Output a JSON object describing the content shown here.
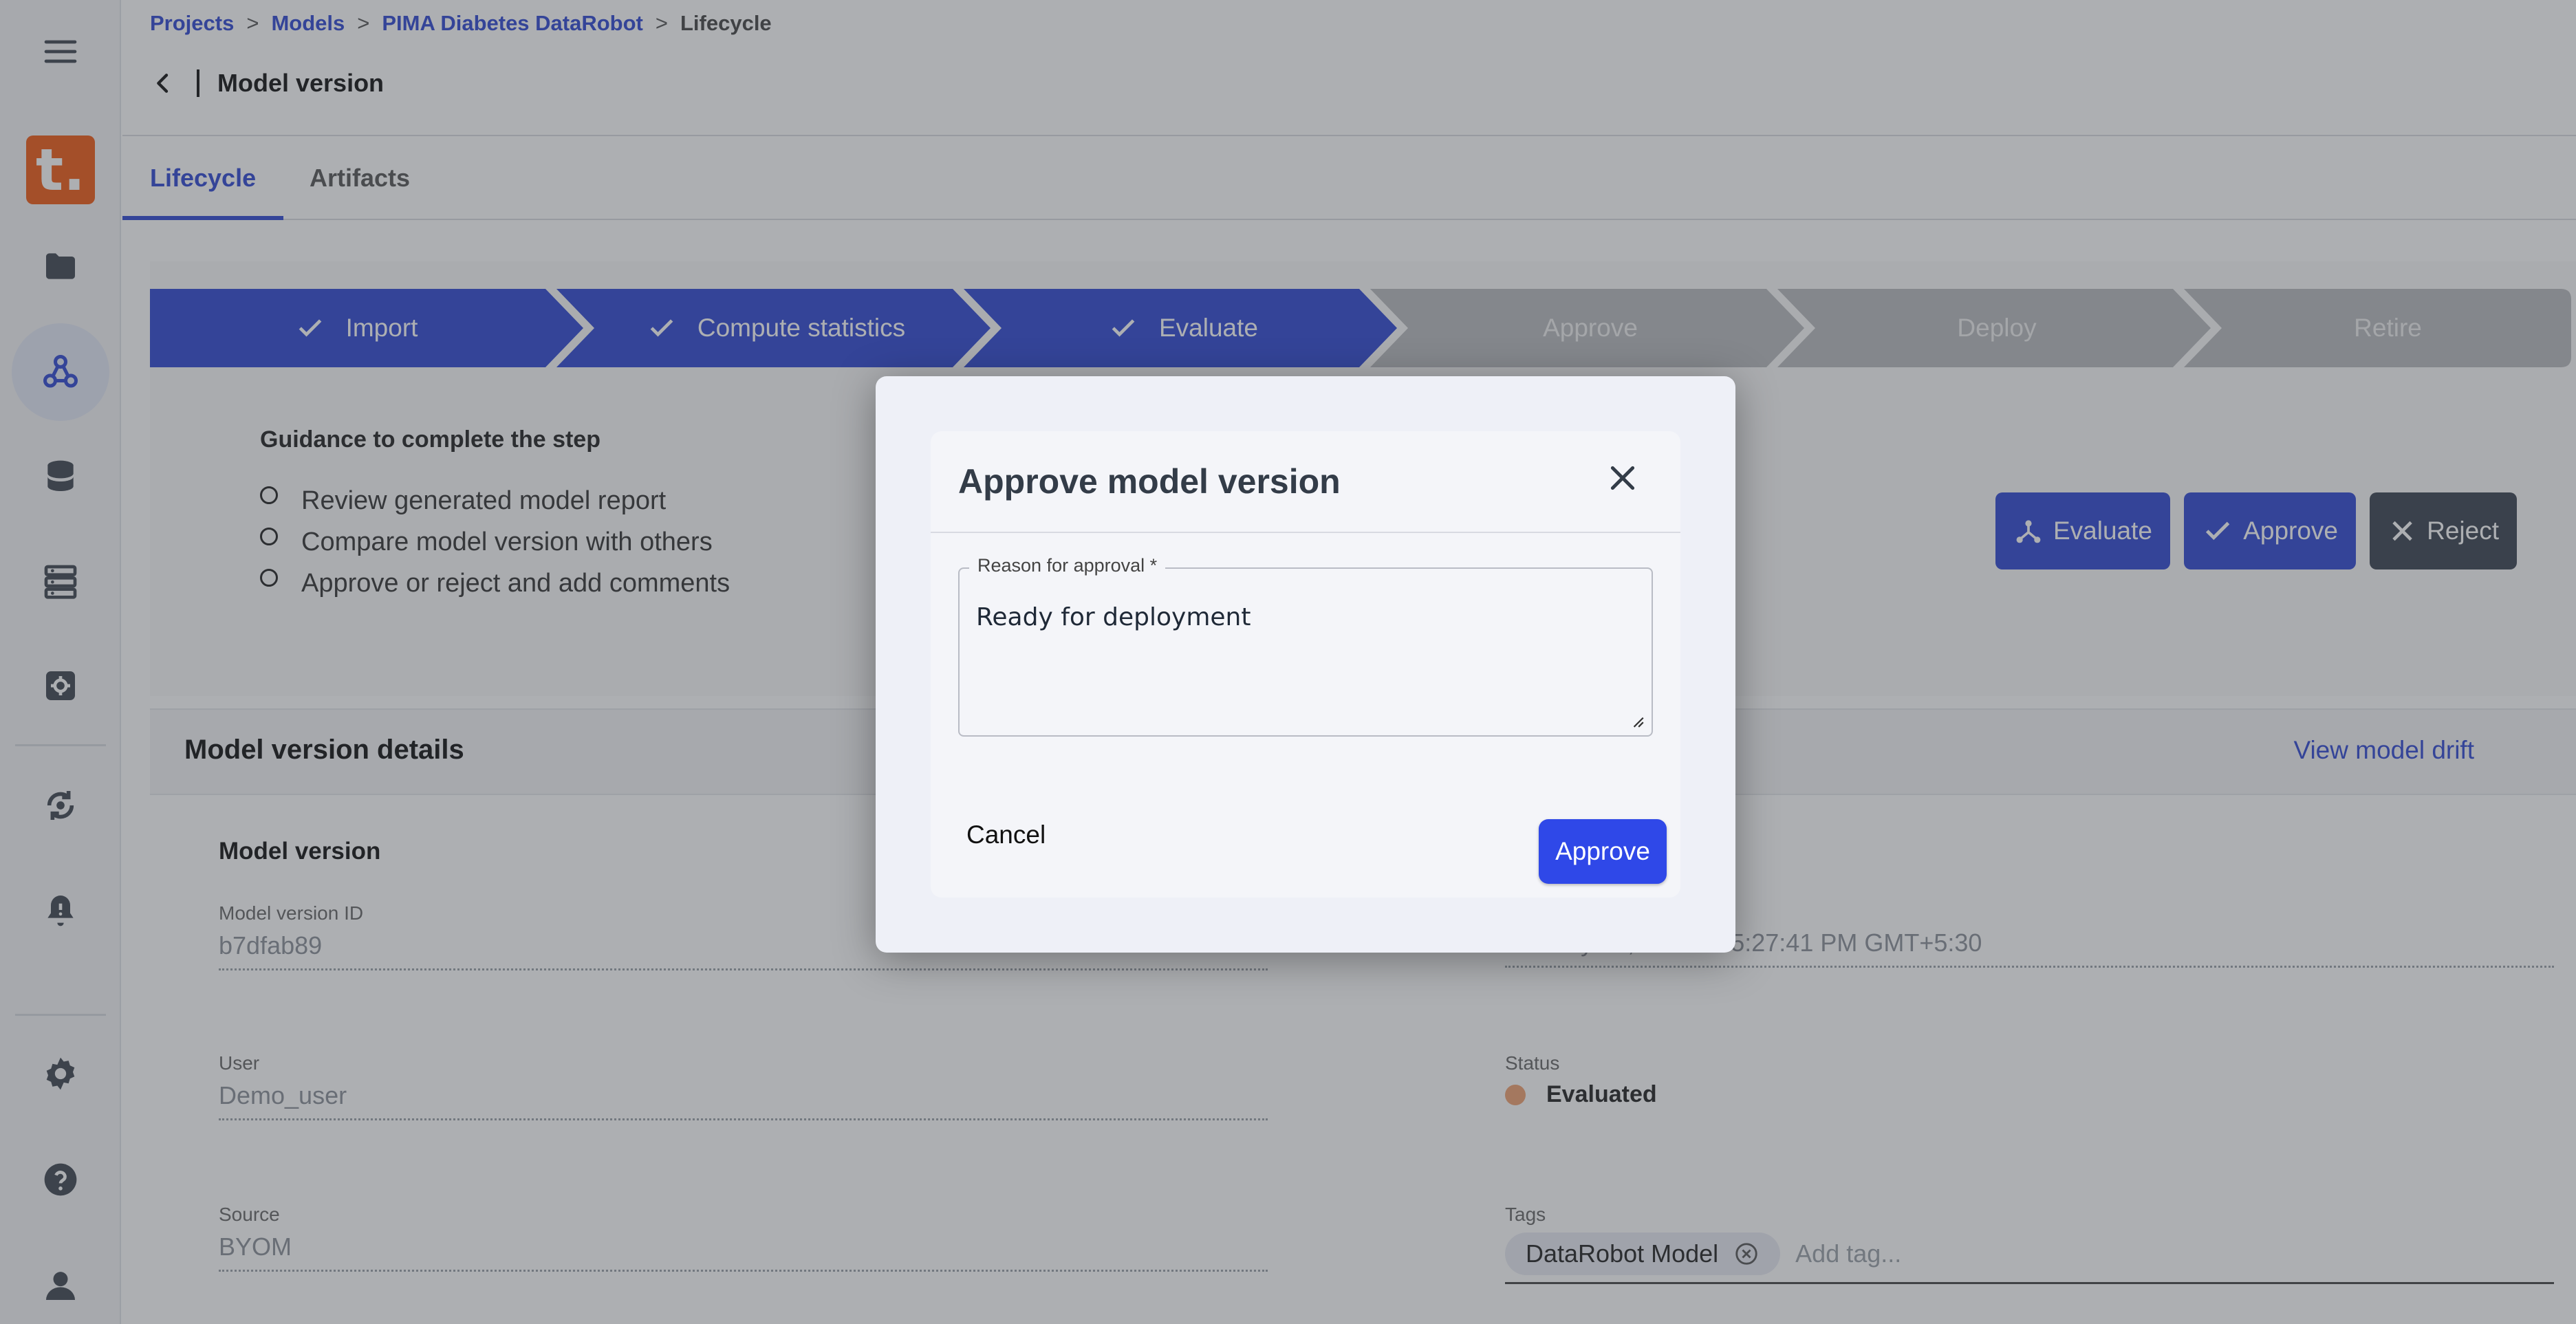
{
  "breadcrumb": {
    "projects": "Projects",
    "models": "Models",
    "project_name": "PIMA Diabetes DataRobot",
    "current": "Lifecycle",
    "sep": ">"
  },
  "header": {
    "title": "Model version"
  },
  "tabs": [
    {
      "label": "Lifecycle",
      "active": true
    },
    {
      "label": "Artifacts",
      "active": false
    }
  ],
  "stepper": {
    "steps": [
      {
        "label": "Import",
        "done": true
      },
      {
        "label": "Compute statistics",
        "done": true
      },
      {
        "label": "Evaluate",
        "done": true
      },
      {
        "label": "Approve",
        "done": false
      },
      {
        "label": "Deploy",
        "done": false
      },
      {
        "label": "Retire",
        "done": false
      }
    ]
  },
  "guidance": {
    "title": "Guidance to complete the step",
    "items": [
      "Review generated model report",
      "Compare model version with others",
      "Approve or reject and add comments"
    ]
  },
  "actions": {
    "evaluate": "Evaluate",
    "approve": "Approve",
    "reject": "Reject"
  },
  "details": {
    "title": "Model version details",
    "drift_link": "View model drift",
    "section_title": "Model version",
    "fields": {
      "version_id_label": "Model version ID",
      "version_id": "b7dfab89",
      "created_value": "January 20, 2023 at 5:27:41 PM GMT+5:30",
      "user_label": "User",
      "user": "Demo_user",
      "status_label": "Status",
      "status": "Evaluated",
      "source_label": "Source",
      "source": "BYOM",
      "tags_label": "Tags",
      "tag_chip": "DataRobot Model",
      "tag_placeholder": "Add tag..."
    }
  },
  "modal": {
    "title": "Approve model version",
    "field_label": "Reason for approval *",
    "field_value": "Ready for deployment",
    "cancel": "Cancel",
    "approve": "Approve"
  },
  "colors": {
    "accent": "#2f48d3",
    "brand": "#f05a14",
    "step_todo": "#b9babd",
    "reject": "#3a4350",
    "status_evaluated": "#f0a070"
  }
}
